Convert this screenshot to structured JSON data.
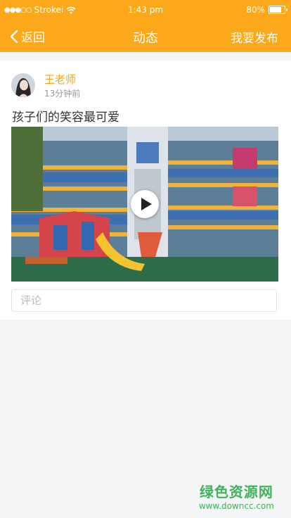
{
  "status_bar": {
    "carrier": "Strokei",
    "time": "1:43 pm",
    "battery_percent": "80%",
    "battery_level": 0.8,
    "signal_icon": "signal-dots-icon",
    "wifi_icon": "wifi-icon",
    "battery_icon": "battery-icon"
  },
  "nav": {
    "back_label": "返回",
    "title": "动态",
    "publish_label": "我要发布",
    "back_icon": "chevron-left-icon",
    "background": "#fda71a"
  },
  "post": {
    "author": "王老师",
    "time_ago": "13分钟前",
    "text": "孩子们的笑容最可爱",
    "play_icon": "play-icon"
  },
  "comment": {
    "placeholder": "评论"
  },
  "watermark": {
    "title": "绿色资源网",
    "url": "www.downcc.com"
  }
}
